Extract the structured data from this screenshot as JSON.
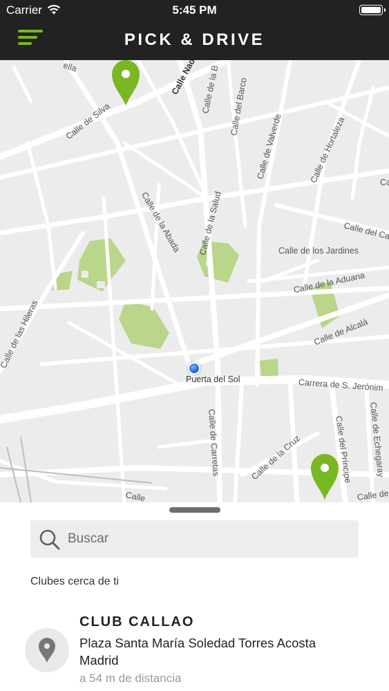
{
  "status_bar": {
    "carrier": "Carrier",
    "time": "5:45 PM"
  },
  "nav": {
    "title": "PICK & DRIVE",
    "menu_icon": "hamburger-menu-icon",
    "accent_color": "#78b823",
    "bar_color": "#222222"
  },
  "map": {
    "streets": [
      "Calle Nao",
      "Calle de la B",
      "Calle del Barco",
      "Calle de Silva",
      "Calle de Valverde",
      "Calle de Hortaleza",
      "Calle de la Abada",
      "Calle de la Salud",
      "Calle de los Jardines",
      "Calle del Ca",
      "Calle de la Aduana",
      "Calle de las Hileras",
      "Calle de Alcalá",
      "Puerta del Sol",
      "Carrera de S. Jerónim",
      "Calle de Carretas",
      "Calle de la Cruz",
      "Calle del Príncipe",
      "Calle de Echegaray",
      "Calle",
      "Calle de",
      "ella",
      "Calle"
    ],
    "pin_color": "#78b823",
    "pin_icon": "map-pin-icon",
    "user_location_icon": "current-location-dot"
  },
  "sheet": {
    "search_placeholder": "Buscar",
    "search_icon": "search-icon",
    "section_title": "Clubes cerca de ti",
    "clubs": [
      {
        "name": "CLUB CALLAO",
        "address": "Plaza Santa María Soledad Torres Acosta",
        "city": "Madrid",
        "distance": "a 54 m de distancia",
        "icon": "location-marker-icon"
      }
    ]
  }
}
